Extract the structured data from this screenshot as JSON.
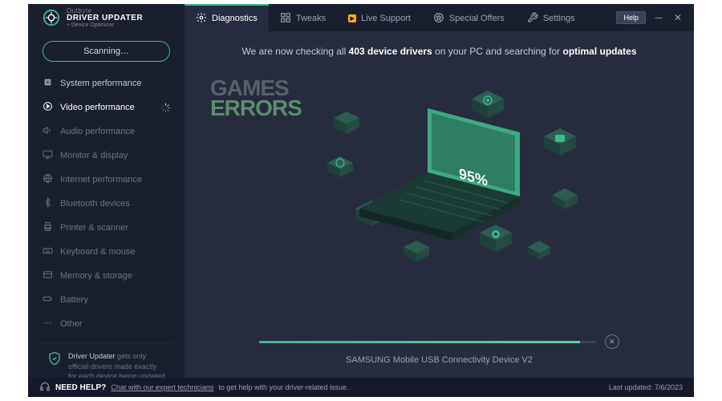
{
  "logo": {
    "brand": "Outbyte",
    "title": "DRIVER UPDATER",
    "sub": "+ Device Optimizer"
  },
  "tabs": [
    {
      "label": "Diagnostics",
      "active": true
    },
    {
      "label": "Tweaks"
    },
    {
      "label": "Live Support",
      "live": true
    },
    {
      "label": "Special Offers"
    },
    {
      "label": "Settings"
    }
  ],
  "header": {
    "help": "Help"
  },
  "sidebar": {
    "scan_label": "Scanning…",
    "items": [
      {
        "label": "System performance",
        "state": "done"
      },
      {
        "label": "Video performance",
        "state": "active"
      },
      {
        "label": "Audio performance",
        "state": "pending"
      },
      {
        "label": "Monitor & display",
        "state": "pending"
      },
      {
        "label": "Internet performance",
        "state": "pending"
      },
      {
        "label": "Bluetooth devices",
        "state": "pending"
      },
      {
        "label": "Printer & scanner",
        "state": "pending"
      },
      {
        "label": "Keyboard & mouse",
        "state": "pending"
      },
      {
        "label": "Memory & storage",
        "state": "pending"
      },
      {
        "label": "Battery",
        "state": "pending"
      },
      {
        "label": "Other",
        "state": "pending"
      }
    ],
    "info": {
      "title": "Driver Updater",
      "body": " gets only official drivers made exactly for each device being updated"
    }
  },
  "main": {
    "status": {
      "pre": "We are now checking all ",
      "count": "403 device drivers",
      "mid": " on your PC and searching for ",
      "suffix": "optimal updates"
    },
    "percent_label": "95%",
    "progress_percent": 95,
    "current_device": "SAMSUNG Mobile USB Connectivity Device V2",
    "watermark": {
      "l1": "GAMES",
      "l2": "ERRORS"
    }
  },
  "footer": {
    "help": "NEED HELP?",
    "link": "Chat with our expert technicians",
    "text": " to get help with your driver-related issue.",
    "updated_label": "Last updated: ",
    "updated_date": "7/6/2023"
  },
  "colors": {
    "accent": "#3db88f",
    "bg": "#262c3d",
    "dark": "#1a1f2e"
  }
}
